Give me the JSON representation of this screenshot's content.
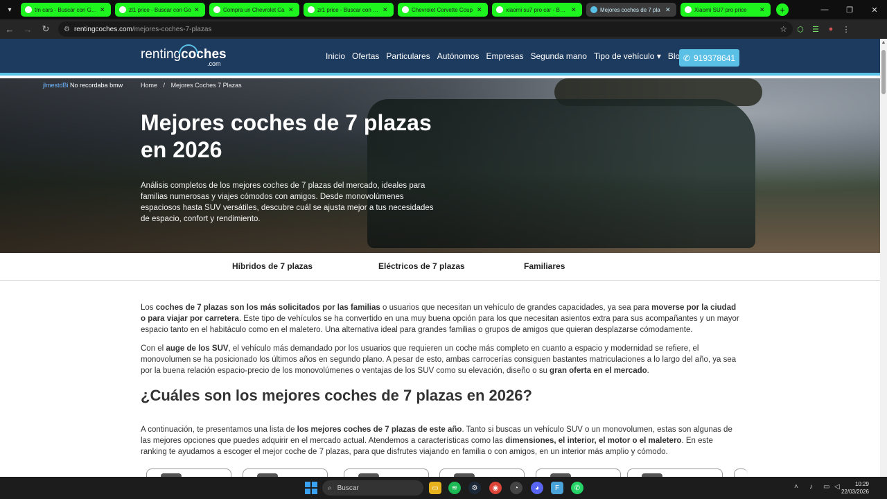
{
  "browser": {
    "tabs": [
      {
        "title": "tm cars - Buscar con Goo",
        "active": false
      },
      {
        "title": "zl1 price - Buscar con Go",
        "active": false
      },
      {
        "title": "Compra un Chevrolet Ca",
        "active": false
      },
      {
        "title": "zr1 price - Buscar con Go",
        "active": false
      },
      {
        "title": "Chevrolet Corvette Coup",
        "active": false
      },
      {
        "title": "xiaomi su7 pro car - Busc",
        "active": false
      },
      {
        "title": "Mejores coches de 7 pla",
        "active": true
      },
      {
        "title": "Xiaomi SU7 pro price",
        "active": false
      }
    ],
    "url_host": "rentingcoches.com",
    "url_path": "/mejores-coches-7-plazas",
    "accent": "#1ef51e"
  },
  "site": {
    "logo_light": "renting",
    "logo_bold": "coches",
    "logo_suffix": ".com",
    "nav": [
      "Inicio",
      "Ofertas",
      "Particulares",
      "Autónomos",
      "Empresas",
      "Segunda mano",
      "Tipo de vehículo ▾",
      "Blog"
    ],
    "phone": "919378641"
  },
  "hero": {
    "user": "jlmestdBi",
    "user_note": "No recordaba bmw",
    "breadcrumb_home": "Home",
    "breadcrumb_sep": "/",
    "breadcrumb_current": "Mejores Coches 7 Plazas",
    "title": "Mejores coches de 7 plazas en 2026",
    "description": "Análisis completos de los mejores coches de 7 plazas del mercado, ideales para familias numerosas y viajes cómodos con amigos. Desde monovolúmenes espaciosos hasta SUV versátiles, descubre cuál se ajusta mejor a tus necesidades de espacio, confort y rendimiento."
  },
  "subnav": [
    "Híbridos de 7 plazas",
    "Eléctricos de 7 plazas",
    "Familiares"
  ],
  "content": {
    "p1": [
      "Los ",
      "coches de 7 plazas son los más solicitados por las familias",
      " o usuarios que necesitan un vehículo de grandes capacidades, ya sea para ",
      "moverse por la ciudad o para viajar por carretera",
      ". Este tipo de vehículos se ha convertido en una muy buena opción para los que necesitan asientos extra para sus acompañantes y un mayor espacio tanto en el habitáculo como en el maletero. Una alternativa ideal para grandes familias o grupos de amigos que quieran desplazarse cómodamente."
    ],
    "p2": [
      "Con el ",
      "auge de los SUV",
      ", el vehículo más demandado por los usuarios que requieren un coche más completo en cuanto a espacio y modernidad se refiere, el monovolumen se ha posicionado los últimos años en segundo plano. A pesar de esto, ambas carrocerías consiguen bastantes matriculaciones a lo largo del año, ya sea por la buena relación espacio-precio de los monovolúmenes o ventajas de los SUV como su elevación, diseño o su ",
      "gran oferta en el mercado",
      "."
    ],
    "h2": "¿Cuáles son los mejores coches de 7 plazas en 2026?",
    "p3": [
      "A continuación, te presentamos una lista de ",
      "los mejores coches de 7 plazas de este año",
      ". Tanto si buscas un vehículo SUV o un monovolumen, estas son algunas de las mejores opciones que puedes adquirir en el mercado actual. Atendemos a características como las ",
      "dimensiones, el interior, el motor o el maletero",
      ". En este ranking te ayudamos a escoger el mejor coche de 7 plazas, para que disfrutes viajando en familia o con amigos, en un interior más amplio y cómodo."
    ]
  },
  "taskbar": {
    "search_placeholder": "Buscar",
    "time": "10:29",
    "date": "22/03/2026",
    "apps": [
      "folder-icon",
      "spotify-icon",
      "steam-icon",
      "chrome-icon",
      "app-icon",
      "discord-icon",
      "f-icon",
      "whatsapp-icon"
    ]
  }
}
